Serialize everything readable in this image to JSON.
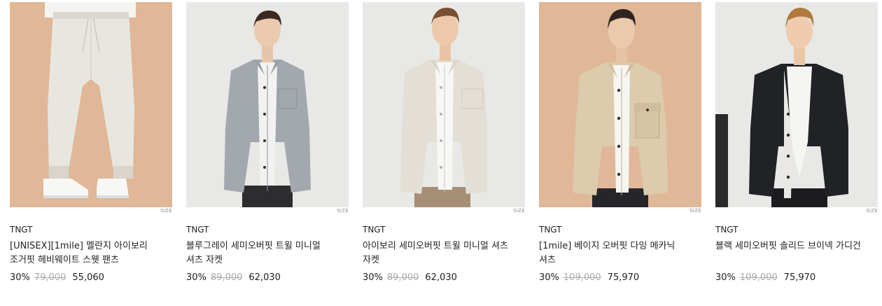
{
  "products": [
    {
      "brand": "TNGT",
      "name": "[UNISEX][1mile] 멜란지 아이보리 조거핏 헤비웨이트 스웻 팬츠",
      "discount": "30%",
      "original_price": "79,000",
      "final_price": "55,060",
      "size_label": "SIZE",
      "image_icon": "model-sweatpants-photo"
    },
    {
      "brand": "TNGT",
      "name": "블루그레이 세미오버핏 트윌 미니멀 셔츠 자켓",
      "discount": "30%",
      "original_price": "89,000",
      "final_price": "62,030",
      "size_label": "SIZE",
      "image_icon": "model-shirt-jacket-photo"
    },
    {
      "brand": "TNGT",
      "name": "아이보리 세미오버핏 트윌 미니멀 셔츠 자켓",
      "discount": "30%",
      "original_price": "89,000",
      "final_price": "62,030",
      "size_label": "SIZE",
      "image_icon": "model-shirt-jacket-photo"
    },
    {
      "brand": "TNGT",
      "name": "[1mile] 베이지 오버핏 다잉 메카닉 셔츠",
      "discount": "30%",
      "original_price": "109,000",
      "final_price": "75,970",
      "size_label": "SIZE",
      "image_icon": "model-mechanic-shirt-photo"
    },
    {
      "brand": "TNGT",
      "name": "블랙 세미오버핏 솔리드 브이넥 가디건",
      "discount": "30%",
      "original_price": "109,000",
      "final_price": "75,970",
      "size_label": "SIZE",
      "image_icon": "model-cardigan-photo"
    }
  ],
  "colors": {
    "bg_peach": "#e0b797",
    "bg_light": "#e8e8e6",
    "grey_jacket": "#a3a8ae",
    "ivory_jacket": "#e4dfd6",
    "beige_shirt": "#dccbad",
    "black_cardigan": "#202226",
    "sweatpant": "#e9e6e0"
  }
}
